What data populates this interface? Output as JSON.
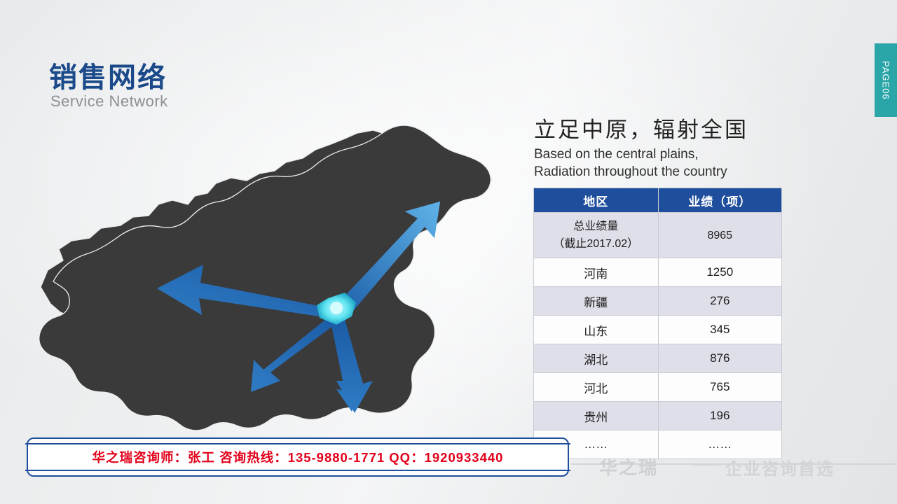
{
  "page_tab": {
    "label": "PAGE06",
    "color": "#2aa5a8"
  },
  "header": {
    "title_zh": "销售网络",
    "title_en": "Service Network",
    "title_color": "#1b4a8a"
  },
  "right_panel": {
    "headline_zh": "立足中原，辐射全国",
    "headline_en_line1": "Based on the central plains,",
    "headline_en_line2": "Radiation throughout the country",
    "table": {
      "header_color": "#1f4e9c",
      "columns": [
        "地区",
        "业绩（项）"
      ],
      "rows": [
        {
          "region": "总业绩量\n（截止2017.02）",
          "region_line1": "总业绩量",
          "region_line2": "（截止2017.02）",
          "value": "8965"
        },
        {
          "region": "河南",
          "value": "1250"
        },
        {
          "region": "新疆",
          "value": "276"
        },
        {
          "region": "山东",
          "value": "345"
        },
        {
          "region": "湖北",
          "value": "876"
        },
        {
          "region": "河北",
          "value": "765"
        },
        {
          "region": "贵州",
          "value": "196"
        },
        {
          "region": "……",
          "value": "……"
        }
      ]
    }
  },
  "contact": {
    "text": "华之瑞咨询师：张工    咨询热线：135-9880-1771   QQ：1920933440",
    "color": "#e2001a"
  },
  "footer": {
    "logo_text": "华之瑞",
    "slogan": "企业咨询首选"
  },
  "map": {
    "name": "china-map",
    "land_color": "#3a3a3a",
    "arrow_color_dark": "#1c5fa8",
    "arrow_color_light": "#4aa3dd",
    "hub_color": "#5fe3f0"
  }
}
